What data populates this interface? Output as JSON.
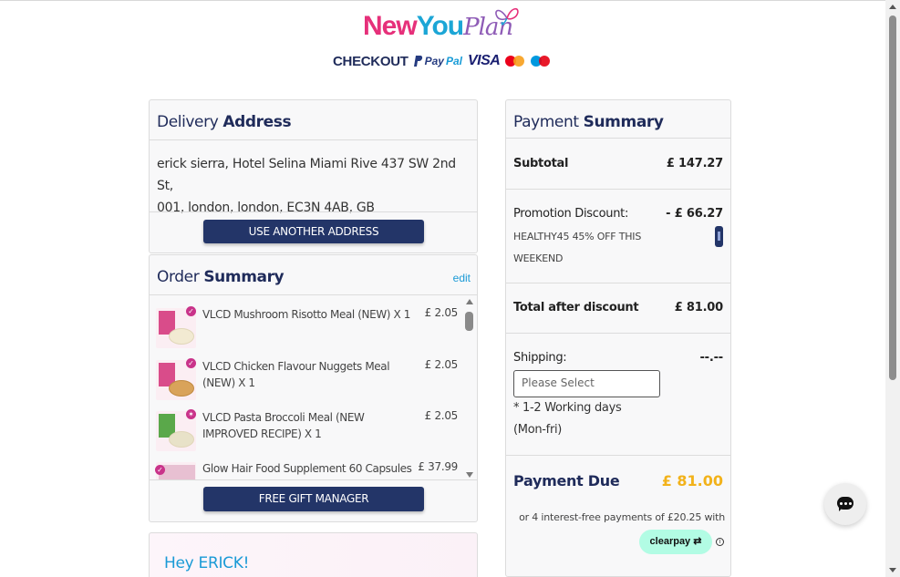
{
  "brand": {
    "part1": "New",
    "part2": "You",
    "part3": "Plan"
  },
  "header": {
    "checkout_label": "CHECKOUT",
    "paypal_p1": "Pay",
    "paypal_p2": "Pal",
    "visa_label": "VISA"
  },
  "delivery": {
    "title_light": "Delivery ",
    "title_bold": "Address",
    "address_line1": "erick sierra, Hotel Selina Miami Rive 437 SW 2nd St,",
    "address_line2": "001, london, london, EC3N 4AB, GB",
    "use_another_label": "USE ANOTHER ADDRESS"
  },
  "order": {
    "title_light": "Order ",
    "title_bold": "Summary",
    "edit_label": "edit",
    "items": [
      {
        "name": "VLCD Mushroom Risotto Meal (NEW) X 1",
        "price": "£ 2.05"
      },
      {
        "name": "VLCD Chicken Flavour Nuggets Meal (NEW) X 1",
        "price": "£ 2.05"
      },
      {
        "name": "VLCD Pasta Broccoli Meal (NEW IMPROVED RECIPE) X 1",
        "price": "£ 2.05"
      },
      {
        "name": "Glow Hair Food Supplement 60 Capsules",
        "price": "£ 37.99"
      }
    ],
    "free_gift_label": "FREE GIFT MANAGER"
  },
  "greeting": {
    "text": "Hey ERICK!"
  },
  "payment": {
    "title_light": "Payment ",
    "title_bold": "Summary",
    "subtotal_label": "Subtotal",
    "subtotal_value": "£ 147.27",
    "promo_label": "Promotion Discount:",
    "promo_value": "- £ 66.27",
    "promo_code_line1": "HEALTHY45 45% OFF THIS",
    "promo_code_line2": "WEEKEND",
    "total_after_label": "Total after discount",
    "total_after_value": "£ 81.00",
    "shipping_label": "Shipping:",
    "shipping_value": "--.--",
    "shipping_placeholder": "Please Select",
    "shipping_note_line1": "* 1-2 Working days",
    "shipping_note_line2": "(Mon-fri)",
    "due_label": "Payment Due",
    "due_value": "£ 81.00",
    "installments_text": "or 4 interest-free payments of £20.25 with",
    "clearpay_label": "clearpay",
    "info_glyph": "i"
  },
  "colors": {
    "navy": "#233568",
    "accent_blue": "#1a9ad6",
    "due_yellow": "#f2b21a",
    "clearpay_mint": "#b2fce4"
  }
}
